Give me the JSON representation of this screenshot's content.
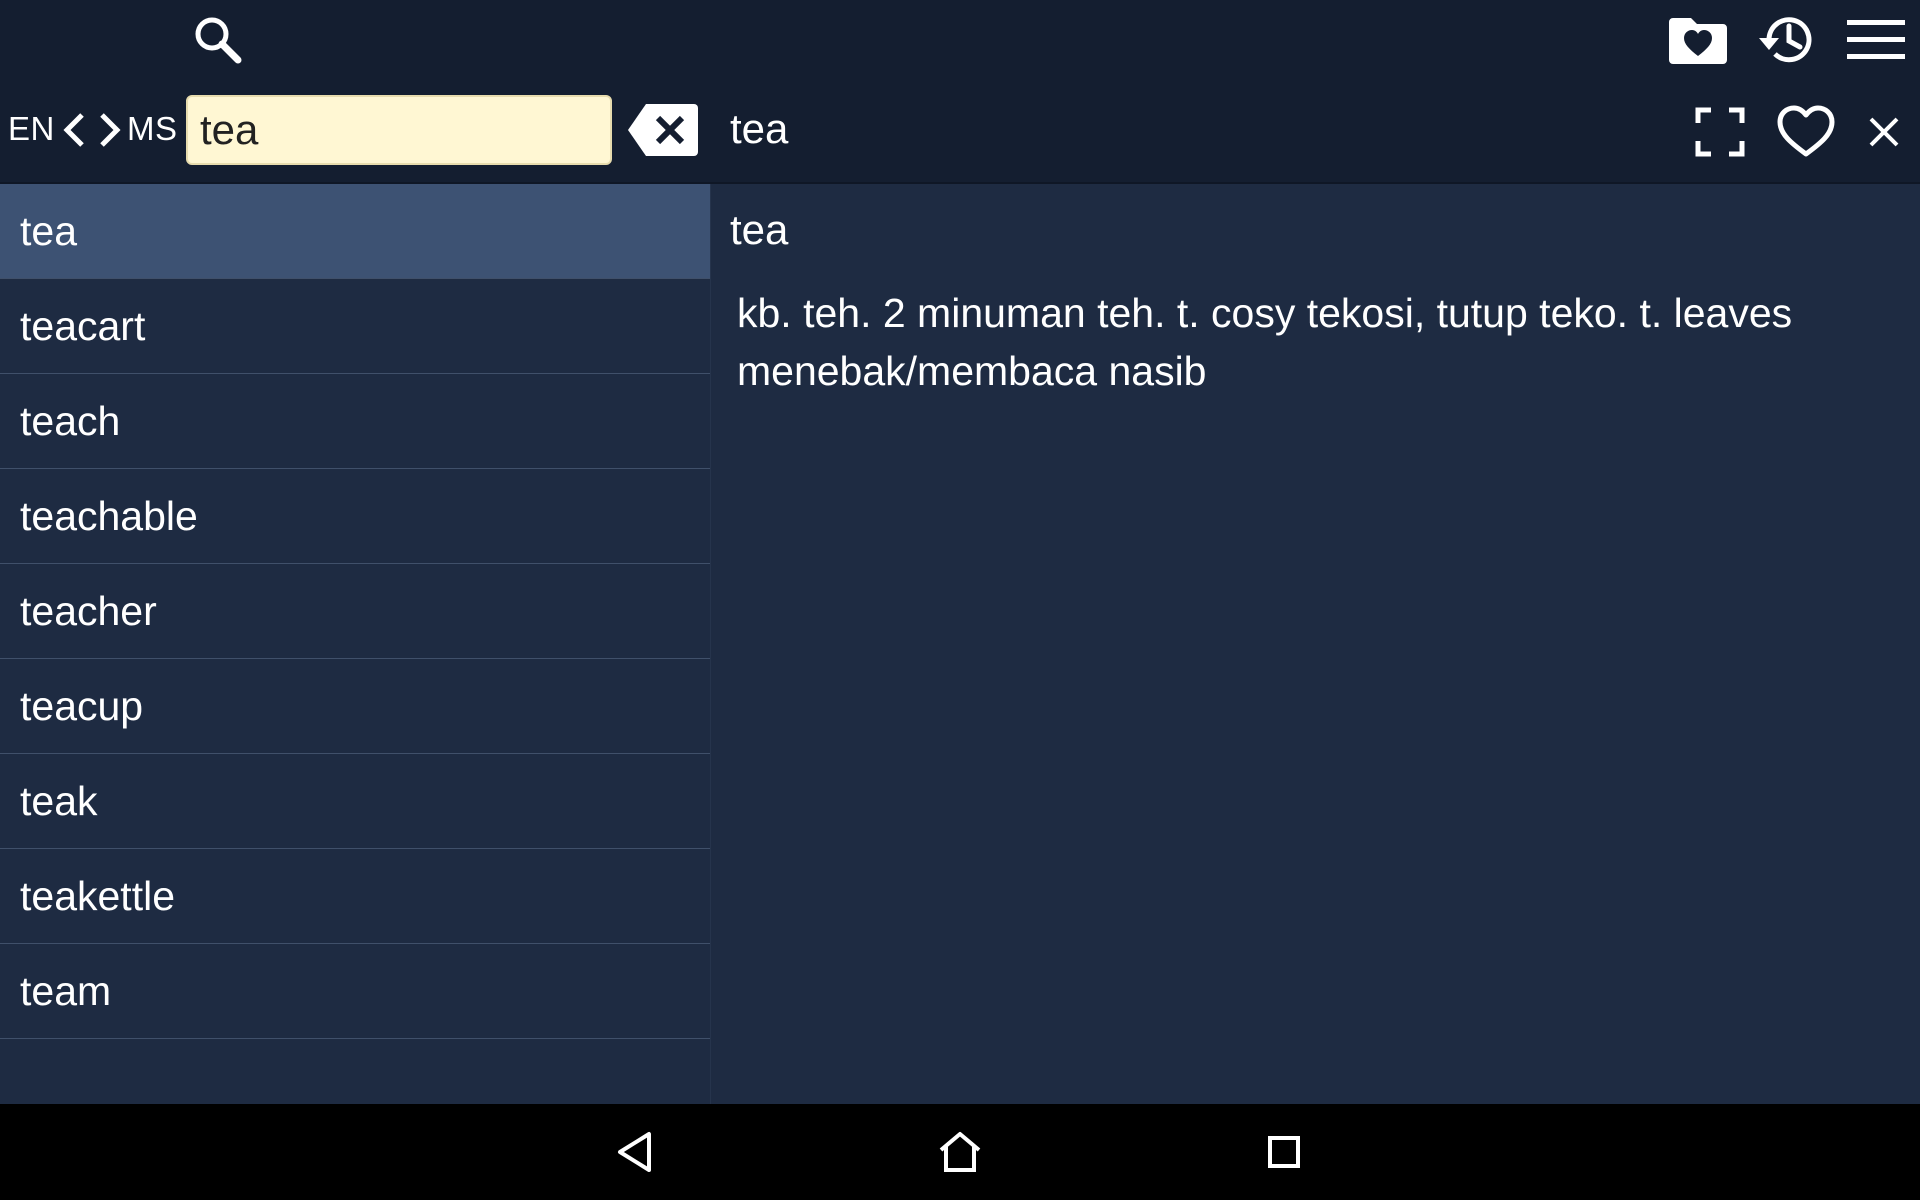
{
  "toolbar": {
    "icons": [
      "search-icon",
      "favorites-folder-icon",
      "history-icon",
      "menu-icon"
    ]
  },
  "search": {
    "source_lang": "EN",
    "target_lang": "MS",
    "value": "tea"
  },
  "header": {
    "word": "tea",
    "icons": [
      "fullscreen-icon",
      "heart-icon",
      "close-icon"
    ]
  },
  "word_list": [
    "tea",
    "teacart",
    "teach",
    "teachable",
    "teacher",
    "teacup",
    "teak",
    "teakettle",
    "team"
  ],
  "definition": {
    "headword": "tea",
    "text": "kb. teh. 2 minuman teh. t. cosy tekosi, tutup teko. t. leaves menebak/membaca nasib"
  },
  "navbar": {
    "icons": [
      "back-icon",
      "home-icon",
      "recents-icon"
    ]
  },
  "colors": {
    "toolbar_bg": "#141e30",
    "content_bg": "#1e2b42",
    "selected_row": "#3d5273",
    "search_input_bg": "#fff7d3"
  }
}
